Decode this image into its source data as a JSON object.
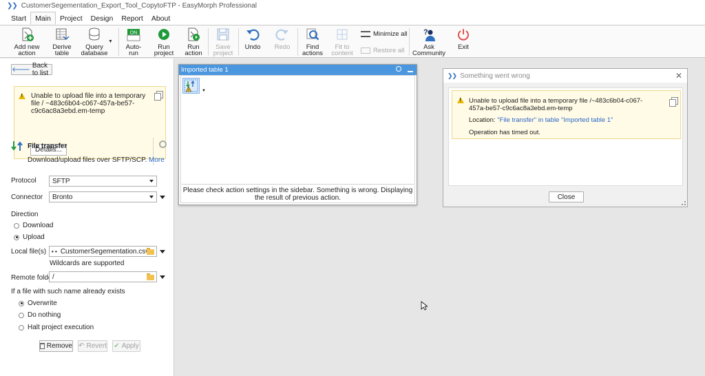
{
  "window": {
    "title": "CustomerSegementation_Export_Tool_CopytoFTP - EasyMorph Professional"
  },
  "menu": {
    "tabs": [
      "Start",
      "Main",
      "Project",
      "Design",
      "Report",
      "About"
    ],
    "active": "Main"
  },
  "ribbon": {
    "add_new_action": "Add new\naction",
    "derive_table": "Derive\ntable",
    "query_database": "Query\ndatabase",
    "auto_run": "Auto-\nrun",
    "auto_run_badge": "ON",
    "run_project": "Run\nproject",
    "run_action": "Run\naction",
    "save_project": "Save\nproject",
    "undo": "Undo",
    "redo": "Redo",
    "find_actions": "Find\nactions",
    "fit_to_content": "Fit to\ncontent",
    "minimize_all": "Minimize all",
    "restore_all": "Restore all",
    "ask_community": "Ask\nCommunity",
    "exit": "Exit"
  },
  "sidebar": {
    "back_label": "Back to list",
    "warning_message": "Unable to upload file into a temporary file / ~483c6b04-c067-457a-be57-c9c6ac8a3ebd.em-temp",
    "details_label": "Details...",
    "action_name": "File transfer",
    "action_description": "Download/upload files over SFTP/SCP.",
    "more_link": "More",
    "protocol_label": "Protocol",
    "protocol_value": "SFTP",
    "connector_label": "Connector",
    "connector_value": "Bronto",
    "direction_label": "Direction",
    "direction_download": "Download",
    "direction_upload": "Upload",
    "local_files_label": "Local file(s)",
    "local_files_prefix": "• •",
    "local_files_value": "CustomerSegementation.csv",
    "wildcards_note": "Wildcards are supported",
    "remote_folder_label": "Remote folder",
    "remote_folder_value": "/",
    "exists_label": "If a file with such name already exists",
    "opt_overwrite": "Overwrite",
    "opt_do_nothing": "Do nothing",
    "opt_halt": "Halt project execution",
    "remove_label": "Remove",
    "revert_label": "Revert",
    "apply_label": "Apply"
  },
  "table_window": {
    "title": "Imported table 1",
    "message": "Please check action settings in the sidebar. Something is wrong. Displaying the result of previous action."
  },
  "error_dialog": {
    "title": "Something went wrong",
    "message": "Unable to upload file into a temporary file /~483c6b04-c067-457a-be57-c9c6ac8a3ebd.em-temp",
    "location_label": "Location:",
    "location_value": "\"File transfer\" in table \"Imported table 1\"",
    "detail": "Operation has timed out.",
    "close_label": "Close"
  },
  "colors": {
    "accent": "#4a96df",
    "warning_bg": "#fffbe6",
    "link": "#2b67c9",
    "run_green": "#1f9a3a",
    "exit_red": "#e04040"
  }
}
